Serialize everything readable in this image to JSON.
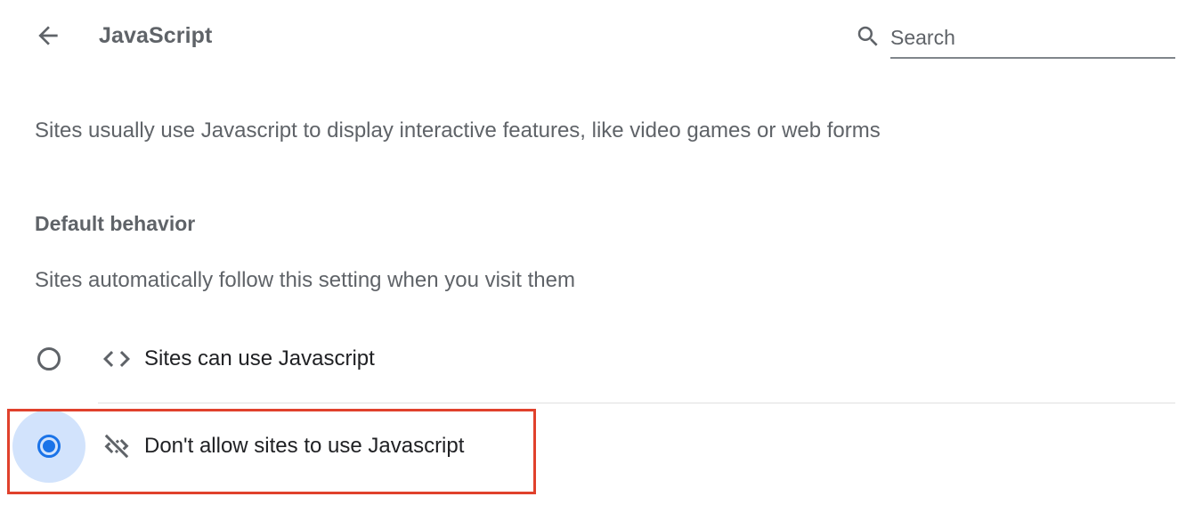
{
  "header": {
    "title": "JavaScript",
    "back_icon": "arrow-back-icon",
    "search": {
      "icon": "search-icon",
      "placeholder": "Search",
      "value": ""
    }
  },
  "description": "Sites usually use Javascript to display interactive features, like video games or web forms",
  "default_behavior": {
    "heading": "Default behavior",
    "subtitle": "Sites automatically follow this setting when you visit them",
    "options": [
      {
        "label": "Sites can use Javascript",
        "icon": "code-icon",
        "selected": false
      },
      {
        "label": "Don't allow sites to use Javascript",
        "icon": "code-off-icon",
        "selected": true
      }
    ]
  },
  "colors": {
    "accent": "#1a73e8",
    "focus_halo": "#d2e3fc",
    "highlight_border": "#e0412c",
    "secondary_text": "#5f6368"
  }
}
